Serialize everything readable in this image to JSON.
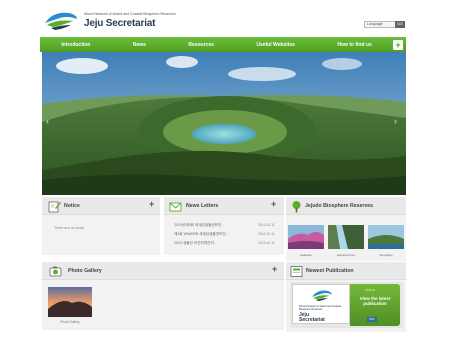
{
  "header": {
    "logo_small": "World Network of Island and Coastal Biosphere Reserves",
    "logo_big": "Jeju Secretariat",
    "language_select": "Language",
    "language_go": "GO"
  },
  "nav": {
    "items": [
      "Introduction",
      "News",
      "Resources",
      "Useful Websites",
      "How to find us"
    ],
    "plus": "+"
  },
  "hero": {
    "prev": "‹",
    "next": "›"
  },
  "notice": {
    "title": "Notice",
    "plus": "+",
    "empty_text": "There are no posts"
  },
  "news": {
    "title": "News Letters",
    "plus": "+",
    "items": [
      {
        "title": "2013년제4회 세계섬생물권보전...",
        "date": "2013.10.11"
      },
      {
        "title": "제4회 WNICBR 세계섬생물권보전...",
        "date": "2013.10.11"
      },
      {
        "title": "2013 생물권 보전지역관리...",
        "date": "2013.10.11"
      }
    ]
  },
  "reserves": {
    "title": "Jejudo Biosphere Reserves",
    "thumbs": [
      {
        "caption": "Hallasan"
      },
      {
        "caption": "Hyodoncheon"
      },
      {
        "caption": "Seogwipo"
      }
    ]
  },
  "gallery": {
    "title": "Photo Gallery",
    "plus": "+",
    "caption": "Photo Gallery"
  },
  "publication": {
    "title": "Newest Publication",
    "book_text_1": "World Network of Island and Coastal Biosphere Reserves",
    "book_text_2": "Jeju Secretariat",
    "green_tag": "2013.10",
    "green_text": "View the latest publication",
    "mini_button": "PDF"
  },
  "colors": {
    "nav_green": "#5aad2c",
    "panel_bg": "#f2f2f2",
    "logo_navy": "#2a3d4f"
  }
}
